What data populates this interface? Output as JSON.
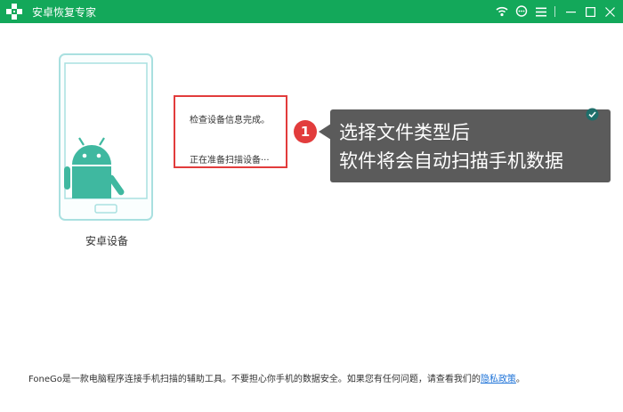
{
  "window": {
    "title": "安卓恢复专家",
    "logo_icon": "plus-logo",
    "controls": [
      "wifi-icon",
      "feedback-icon",
      "menu-icon",
      "minimize-icon",
      "maximize-icon",
      "close-icon"
    ]
  },
  "device": {
    "label": "安卓设备",
    "illustration": "android-phone"
  },
  "status": {
    "line1": "检查设备信息完成。",
    "line2": "正在准备扫描设备···"
  },
  "tip": {
    "step": "1",
    "line1": "选择文件类型后",
    "line2": "软件将会自动扫描手机数据"
  },
  "footer": {
    "text": "FoneGo是一款电脑程序连接手机扫描的辅助工具。不要担心你手机的数据安全。如果您有任何问题，请查看我们的",
    "link": "隐私政策",
    "suffix": "。"
  },
  "colors": {
    "titlebar": "#13a85a",
    "highlight_border": "#e23c3c",
    "tip_background": "#5b5b5b",
    "phone_outline": "#a9e0e0",
    "android": "#3fb8a0",
    "link": "#1e73d8"
  }
}
